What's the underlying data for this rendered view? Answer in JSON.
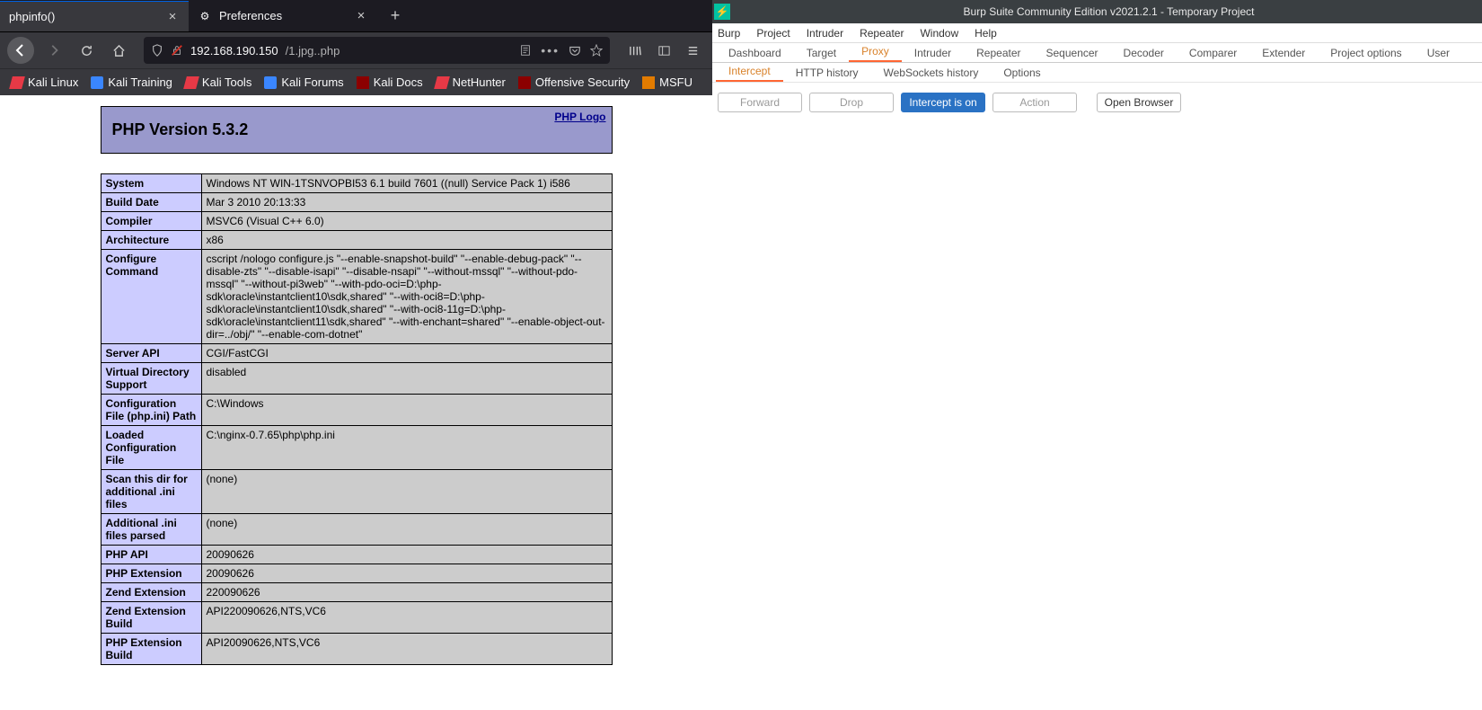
{
  "browser": {
    "tabs": [
      {
        "title": "phpinfo()",
        "active": true
      },
      {
        "title": "Preferences",
        "active": false
      }
    ],
    "url": {
      "host": "192.168.190.150",
      "path": "/1.jpg..php"
    },
    "bookmarks": [
      {
        "label": "Kali Linux",
        "icon": "red"
      },
      {
        "label": "Kali Training",
        "icon": "blue"
      },
      {
        "label": "Kali Tools",
        "icon": "red"
      },
      {
        "label": "Kali Forums",
        "icon": "blue"
      },
      {
        "label": "Kali Docs",
        "icon": "dark"
      },
      {
        "label": "NetHunter",
        "icon": "red"
      },
      {
        "label": "Offensive Security",
        "icon": "dark"
      },
      {
        "label": "MSFU",
        "icon": "orange"
      }
    ]
  },
  "phpinfo": {
    "title": "PHP Version 5.3.2",
    "logo_text": "PHP Logo",
    "rows": [
      {
        "k": "System",
        "v": "Windows NT WIN-1TSNVOPBI53 6.1 build 7601 ((null) Service Pack 1) i586"
      },
      {
        "k": "Build Date",
        "v": "Mar 3 2010 20:13:33"
      },
      {
        "k": "Compiler",
        "v": "MSVC6 (Visual C++ 6.0)"
      },
      {
        "k": "Architecture",
        "v": "x86"
      },
      {
        "k": "Configure Command",
        "v": "cscript /nologo configure.js \"--enable-snapshot-build\" \"--enable-debug-pack\" \"--disable-zts\" \"--disable-isapi\" \"--disable-nsapi\" \"--without-mssql\" \"--without-pdo-mssql\" \"--without-pi3web\" \"--with-pdo-oci=D:\\php-sdk\\oracle\\instantclient10\\sdk,shared\" \"--with-oci8=D:\\php-sdk\\oracle\\instantclient10\\sdk,shared\" \"--with-oci8-11g=D:\\php-sdk\\oracle\\instantclient11\\sdk,shared\" \"--with-enchant=shared\" \"--enable-object-out-dir=../obj/\" \"--enable-com-dotnet\""
      },
      {
        "k": "Server API",
        "v": "CGI/FastCGI"
      },
      {
        "k": "Virtual Directory Support",
        "v": "disabled"
      },
      {
        "k": "Configuration File (php.ini) Path",
        "v": "C:\\Windows"
      },
      {
        "k": "Loaded Configuration File",
        "v": "C:\\nginx-0.7.65\\php\\php.ini"
      },
      {
        "k": "Scan this dir for additional .ini files",
        "v": "(none)"
      },
      {
        "k": "Additional .ini files parsed",
        "v": "(none)"
      },
      {
        "k": "PHP API",
        "v": "20090626"
      },
      {
        "k": "PHP Extension",
        "v": "20090626"
      },
      {
        "k": "Zend Extension",
        "v": "220090626"
      },
      {
        "k": "Zend Extension Build",
        "v": "API220090626,NTS,VC6"
      },
      {
        "k": "PHP Extension Build",
        "v": "API20090626,NTS,VC6"
      }
    ]
  },
  "burp": {
    "title": "Burp Suite Community Edition v2021.2.1 - Temporary Project",
    "menu": [
      "Burp",
      "Project",
      "Intruder",
      "Repeater",
      "Window",
      "Help"
    ],
    "tabs": [
      "Dashboard",
      "Target",
      "Proxy",
      "Intruder",
      "Repeater",
      "Sequencer",
      "Decoder",
      "Comparer",
      "Extender",
      "Project options",
      "User"
    ],
    "active_tab": "Proxy",
    "subtabs": [
      "Intercept",
      "HTTP history",
      "WebSockets history",
      "Options"
    ],
    "active_subtab": "Intercept",
    "buttons": {
      "forward": "Forward",
      "drop": "Drop",
      "intercept": "Intercept is on",
      "action": "Action",
      "open_browser": "Open Browser"
    }
  }
}
